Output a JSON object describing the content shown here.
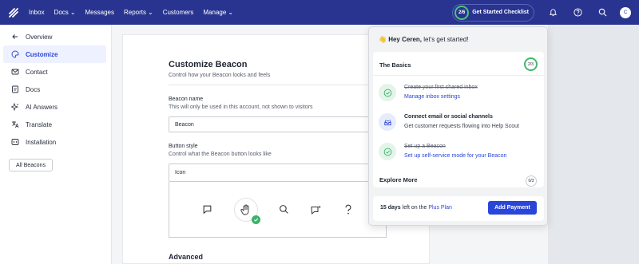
{
  "nav": {
    "items": [
      {
        "label": "Inbox",
        "caret": false
      },
      {
        "label": "Docs",
        "caret": true
      },
      {
        "label": "Messages",
        "caret": false
      },
      {
        "label": "Reports",
        "caret": true
      },
      {
        "label": "Customers",
        "caret": false
      },
      {
        "label": "Manage",
        "caret": true
      }
    ],
    "checklist_label": "Get Started Checklist",
    "checklist_progress": "2/6",
    "avatar_initial": "C"
  },
  "sidebar": {
    "items": [
      {
        "label": "Overview",
        "icon": "arrow-left-icon"
      },
      {
        "label": "Customize",
        "icon": "palette-icon",
        "active": true
      },
      {
        "label": "Contact",
        "icon": "envelope-icon"
      },
      {
        "label": "Docs",
        "icon": "document-icon"
      },
      {
        "label": "AI Answers",
        "icon": "sparkle-icon"
      },
      {
        "label": "Translate",
        "icon": "translate-icon"
      },
      {
        "label": "Installation",
        "icon": "code-icon"
      }
    ],
    "all_beacons_label": "All Beacons"
  },
  "main": {
    "title": "Customize Beacon",
    "subtitle": "Control how your Beacon looks and feels",
    "name_label": "Beacon name",
    "name_hint": "This will only be used in this account, not shown to visitors",
    "name_value": "Beacon",
    "style_label": "Button style",
    "style_hint": "Control what the Beacon button looks like",
    "style_value": "Icon",
    "advanced_title": "Advanced",
    "accent_color": "#3a4fd8"
  },
  "checklist": {
    "greeting_emoji": "👋",
    "greeting_bold": "Hey Ceren,",
    "greeting_rest": " let's get started!",
    "basics_title": "The Basics",
    "basics_progress": "2/3",
    "tasks": [
      {
        "title": "Create your first shared inbox",
        "sub": "Manage inbox settings",
        "done": true
      },
      {
        "title": "Connect email or social channels",
        "sub": "Get customer requests flowing into Help Scout",
        "done": false
      },
      {
        "title": "Set up a Beacon",
        "sub": "Set up self-service mode for your Beacon",
        "done": true
      }
    ],
    "explore_title": "Explore More",
    "explore_progress": "0/3",
    "plan_days": "15 days",
    "plan_mid": " left on the ",
    "plan_link": "Plus Plan",
    "pay_label": "Add Payment"
  }
}
